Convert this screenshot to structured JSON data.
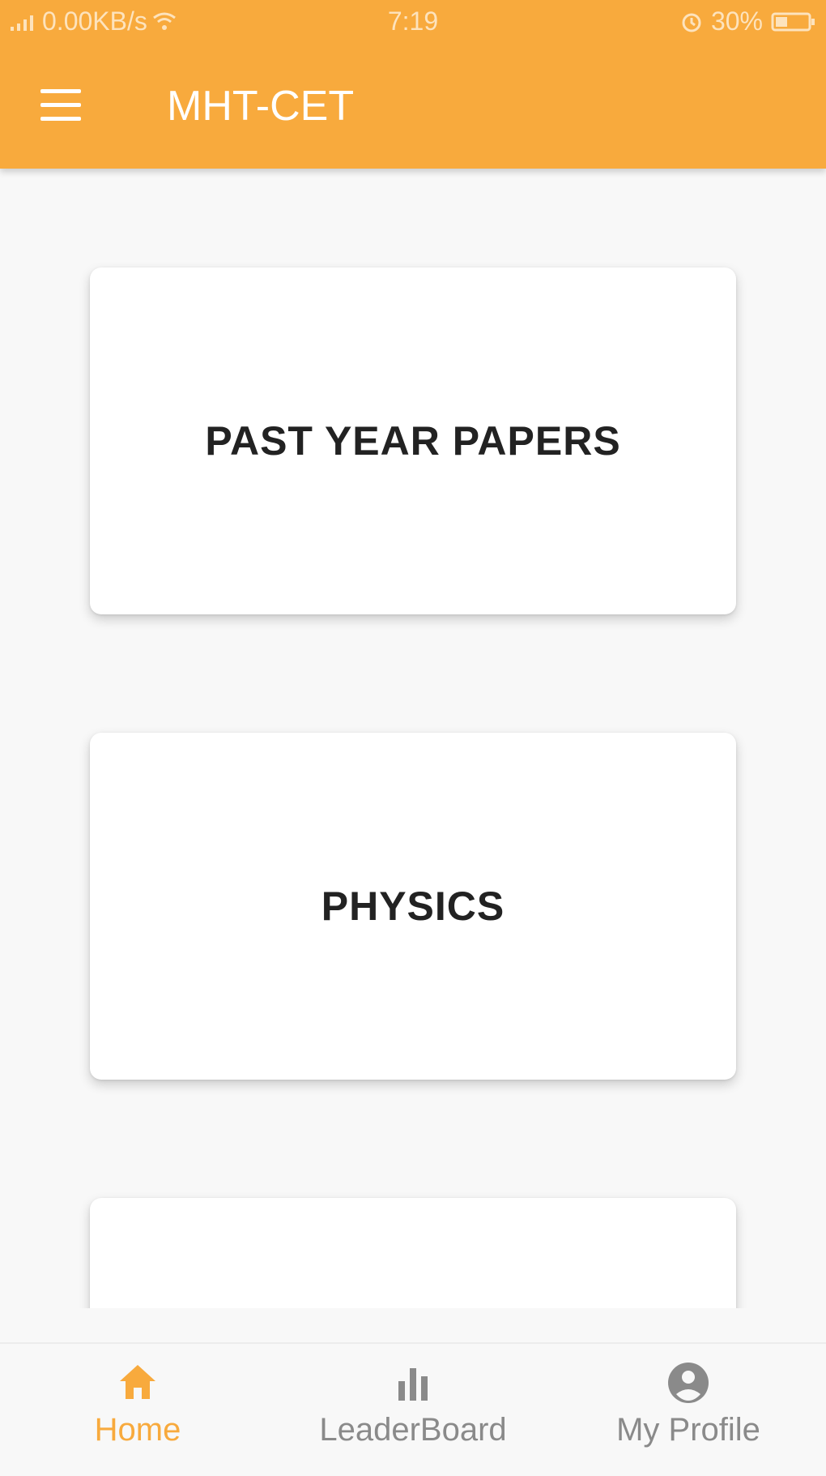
{
  "colors": {
    "primary": "#f8aa3d",
    "nav_inactive": "#8a8a8a",
    "card_text": "#222222"
  },
  "status_bar": {
    "network_speed": "0.00KB/s",
    "time": "7:19",
    "battery": "30%",
    "icons": [
      "signal-icon",
      "wifi-icon",
      "alarm-icon",
      "battery-icon"
    ]
  },
  "app_bar": {
    "title": "MHT-CET",
    "menu_icon": "menu-icon"
  },
  "cards": [
    {
      "label": "PAST YEAR PAPERS"
    },
    {
      "label": "PHYSICS"
    },
    {
      "label": ""
    }
  ],
  "bottom_nav": {
    "items": [
      {
        "label": "Home",
        "icon": "home-icon",
        "active": true
      },
      {
        "label": "LeaderBoard",
        "icon": "leaderboard-icon",
        "active": false
      },
      {
        "label": "My Profile",
        "icon": "profile-icon",
        "active": false
      }
    ]
  }
}
